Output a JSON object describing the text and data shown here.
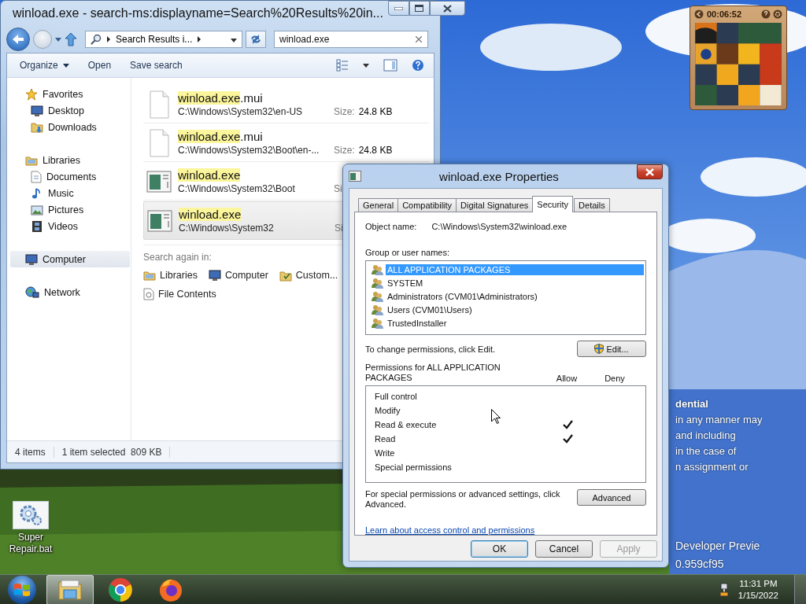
{
  "explorer": {
    "title": "winload.exe - search-ms:displayname=Search%20Results%20in...",
    "breadcrumb": "Search Results i...",
    "search": {
      "value": "winload.exe"
    },
    "toolbar": [
      "Organize",
      "Open",
      "Save search"
    ],
    "nav": [
      {
        "label": "Favorites",
        "selected": false,
        "children": [
          {
            "label": "Desktop",
            "selected": false
          },
          {
            "label": "Downloads",
            "selected": false
          }
        ]
      },
      {
        "label": "Libraries",
        "selected": false,
        "children": [
          {
            "label": "Documents",
            "selected": false
          },
          {
            "label": "Music",
            "selected": false
          },
          {
            "label": "Pictures",
            "selected": false
          },
          {
            "label": "Videos",
            "selected": false
          }
        ]
      },
      {
        "label": "Computer",
        "selected": true
      },
      {
        "label": "Network",
        "selected": false
      }
    ],
    "results": [
      {
        "kind": "document",
        "match": "winload.exe",
        "rest": ".mui",
        "path": "C:\\Windows\\System32\\en-US",
        "size_label": "Size:",
        "size": "24.8 KB",
        "selected": false
      },
      {
        "kind": "document",
        "match": "winload.exe",
        "rest": ".mui",
        "path": "C:\\Windows\\System32\\Boot\\en-...",
        "size_label": "Size:",
        "size": "24.8 KB",
        "selected": false
      },
      {
        "kind": "program",
        "match": "winload.exe",
        "path": "C:\\Windows\\System32\\Boot",
        "size_label": "Si",
        "selected": false
      },
      {
        "kind": "program",
        "match": "winload.exe",
        "path": "C:\\Windows\\System32",
        "size_label": "Si",
        "selected": true
      }
    ],
    "search_again": {
      "label": "Search again in:",
      "items": [
        "Libraries",
        "Computer",
        "Custom...",
        "File Contents"
      ]
    },
    "status": [
      "4 items",
      "1 item selected  809 KB"
    ]
  },
  "properties": {
    "title": "winload.exe Properties",
    "tabs": [
      {
        "label": "General",
        "selected": false
      },
      {
        "label": "Compatibility",
        "selected": false
      },
      {
        "label": "Digital Signatures",
        "selected": false
      },
      {
        "label": "Security",
        "selected": true
      },
      {
        "label": "Details",
        "selected": false
      }
    ],
    "object_label": "Object name:",
    "object_value": "C:\\Windows\\System32\\winload.exe",
    "groups_label": "Group or user names:",
    "groups": [
      {
        "name": "ALL APPLICATION PACKAGES",
        "selected": true
      },
      {
        "name": "SYSTEM",
        "selected": false
      },
      {
        "name": "Administrators (CVM01\\Administrators)",
        "selected": false
      },
      {
        "name": "Users (CVM01\\Users)",
        "selected": false
      },
      {
        "name": "TrustedInstaller",
        "selected": false
      }
    ],
    "change_text": "To change permissions, click Edit.",
    "edit_button": "Edit...",
    "permissions_label": "Permissions for ALL APPLICATION PACKAGES",
    "allow_header": "Allow",
    "deny_header": "Deny",
    "permissions": [
      {
        "name": "Full control",
        "allow": false,
        "deny": false
      },
      {
        "name": "Modify",
        "allow": false,
        "deny": false
      },
      {
        "name": "Read & execute",
        "allow": true,
        "deny": false
      },
      {
        "name": "Read",
        "allow": true,
        "deny": false
      },
      {
        "name": "Write",
        "allow": false,
        "deny": false
      },
      {
        "name": "Special permissions",
        "allow": false,
        "deny": false
      }
    ],
    "advanced_text": "For special permissions or advanced settings, click Advanced.",
    "advanced_button": "Advanced",
    "link": "Learn about access control and permissions",
    "buttons": [
      {
        "label": "OK",
        "default": true,
        "disabled": false
      },
      {
        "label": "Cancel",
        "default": false,
        "disabled": false
      },
      {
        "label": "Apply",
        "default": false,
        "disabled": true
      }
    ]
  },
  "gadget": {
    "time": "00:06:52"
  },
  "desktop": {
    "icons": [
      {
        "label": "Super Repair.bat"
      }
    ],
    "notice": {
      "heading": "dential",
      "lines": [
        "in any manner may",
        "and including",
        "in the case of",
        "n assignment or"
      ],
      "footer": [
        "Developer Previe",
        "0.959cf95"
      ]
    }
  },
  "taskbar": {
    "apps": [
      {
        "kind": "files",
        "selected": true
      },
      {
        "kind": "ring",
        "selected": false
      },
      {
        "kind": "flame",
        "selected": false
      }
    ],
    "clock": {
      "time": "11:31 PM",
      "date": "1/15/2022"
    }
  }
}
